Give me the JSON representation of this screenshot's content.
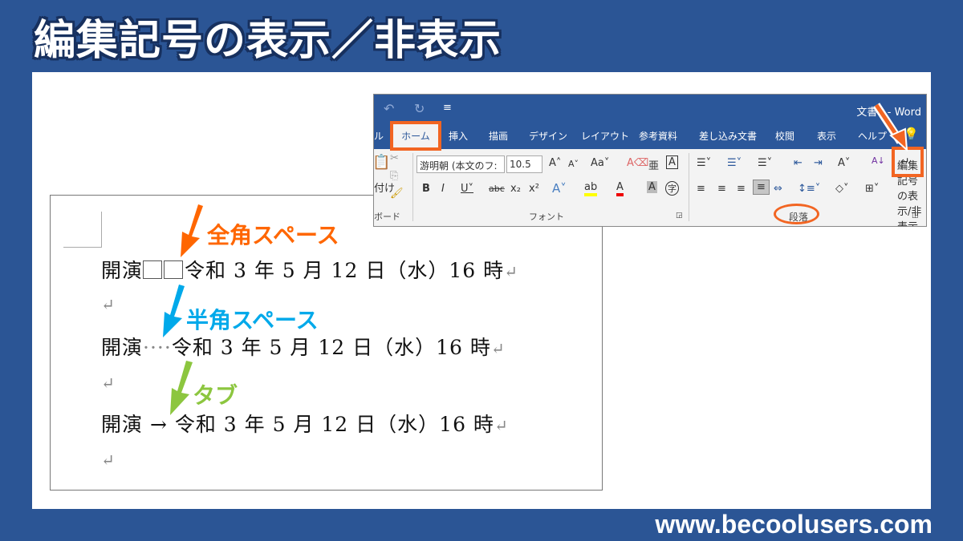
{
  "title": "編集記号の表示／非表示",
  "url": "www.becoolusers.com",
  "document": {
    "lines": [
      {
        "before": "開演",
        "marker": "□□",
        "after": "令和 3 年 5 月 12 日（水）16 時",
        "return": "↵"
      },
      {
        "before": "開演",
        "marker": "····",
        "after": "令和 3 年 5 月 12 日（水）16 時",
        "return": "↵"
      },
      {
        "before": "開演",
        "marker": " → ",
        "after": "令和 3 年 5 月 12 日（水）16 時",
        "return": "↵"
      }
    ],
    "empty_return": "↵"
  },
  "annotations": {
    "fullwidth_space": {
      "label": "全角スペース",
      "color": "#ff6600"
    },
    "halfwidth_space": {
      "label": "半角スペース",
      "color": "#00a0e9"
    },
    "tab": {
      "label": "タブ",
      "color": "#8cc63f"
    }
  },
  "ribbon": {
    "window_title": "文書1 - Word",
    "tabs": [
      "ル",
      "ホーム",
      "挿入",
      "描画",
      "デザイン",
      "レイアウト",
      "参考資料",
      "差し込み文書",
      "校閲",
      "表示",
      "ヘルプ"
    ],
    "active_tab": "ホーム",
    "font_name": "游明朝 (本文のフ:",
    "font_size": "10.5",
    "groups": {
      "clipboard": "ボード",
      "font": "フォント",
      "paragraph": "段落"
    },
    "paste_label": "付け",
    "show_marks_button": "編集記号の表示/非表示",
    "accent_color": "#2b579a",
    "highlight_color": "#f26522"
  }
}
